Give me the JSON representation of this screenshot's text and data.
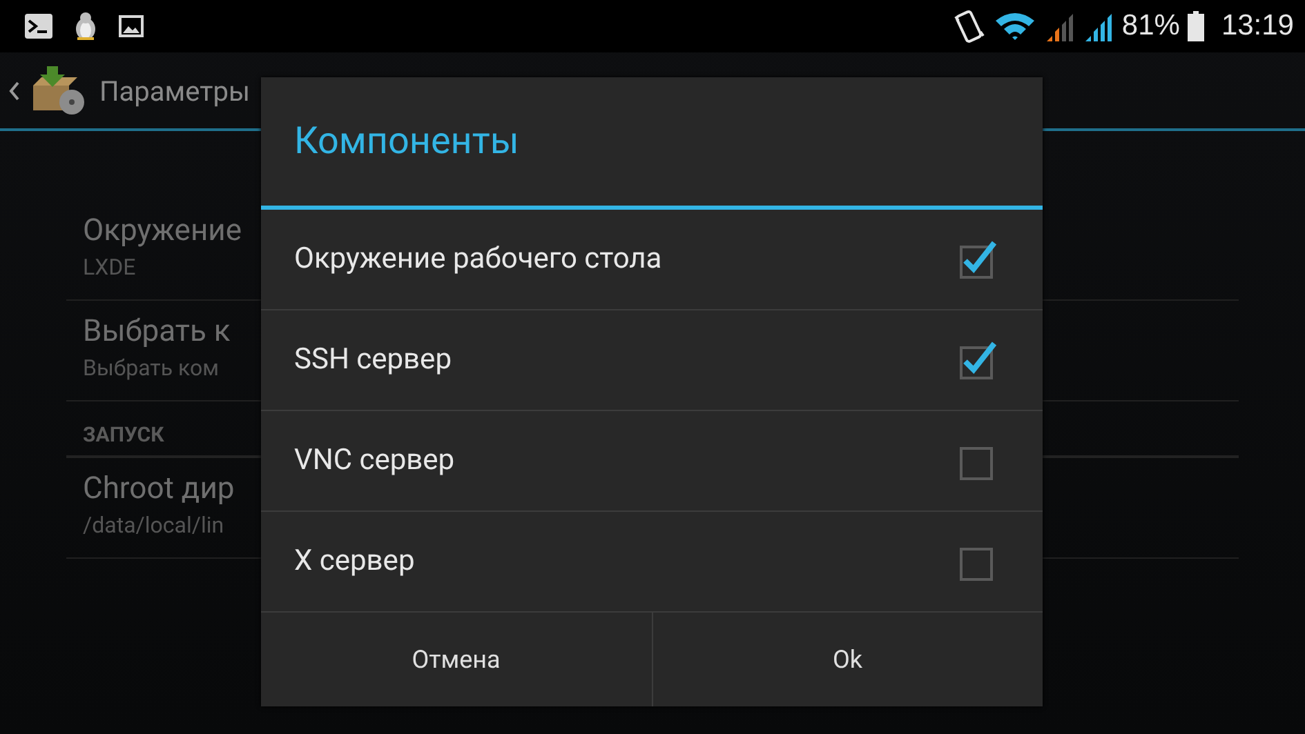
{
  "status_bar": {
    "battery": "81%",
    "time": "13:19"
  },
  "action_bar": {
    "title": "Параметры"
  },
  "settings": [
    {
      "kind": "item",
      "title": "Окружение",
      "summary": "LXDE"
    },
    {
      "kind": "item",
      "title": "Выбрать к",
      "summary": "Выбрать ком"
    },
    {
      "kind": "header",
      "title": "ЗАПУСК"
    },
    {
      "kind": "item",
      "title": "Chroot дир",
      "summary": "/data/local/lin"
    }
  ],
  "dialog": {
    "title": "Компоненты",
    "options": [
      {
        "label": "Окружение рабочего стола",
        "checked": true
      },
      {
        "label": "SSH сервер",
        "checked": true
      },
      {
        "label": "VNC сервер",
        "checked": false
      },
      {
        "label": "X сервер",
        "checked": false
      }
    ],
    "buttons": [
      "Отмена",
      "Ok"
    ]
  }
}
